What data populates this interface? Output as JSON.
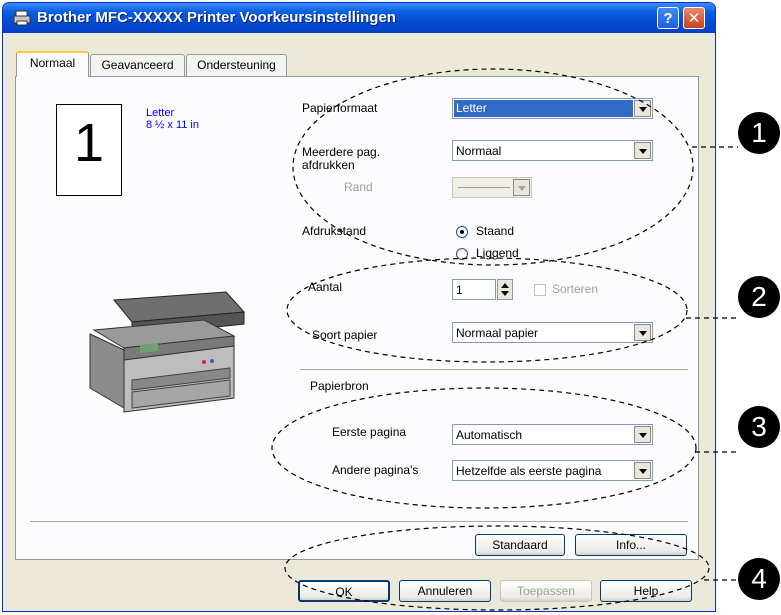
{
  "window": {
    "title": "Brother MFC-XXXXX Printer Voorkeursinstellingen",
    "help_glyph": "?",
    "close_glyph": "✕"
  },
  "tabs": [
    {
      "label": "Normaal"
    },
    {
      "label": "Geavanceerd"
    },
    {
      "label": "Ondersteuning"
    }
  ],
  "preview": {
    "page_number": "1",
    "paper_name": "Letter",
    "paper_size": "8 ½ x 11 in"
  },
  "settings": {
    "papierformaat": {
      "label": "Papierformaat",
      "value": "Letter"
    },
    "meerdere": {
      "label_line1": "Meerdere pag.",
      "label_line2": "afdrukken",
      "value": "Normaal"
    },
    "rand": {
      "label": "Rand"
    },
    "afdrukstand": {
      "label": "Afdrukstand",
      "options": [
        "Staand",
        "Liggend"
      ],
      "selected": "Staand"
    },
    "aantal": {
      "label": "Aantal",
      "value": "1"
    },
    "sorteren": {
      "label": "Sorteren",
      "checked": false
    },
    "soort_papier": {
      "label": "Soort papier",
      "value": "Normaal papier"
    },
    "papierbron": {
      "label": "Papierbron"
    },
    "eerste_pagina": {
      "label": "Eerste pagina",
      "value": "Automatisch"
    },
    "andere_paginas": {
      "label": "Andere pagina's",
      "value": "Hetzelfde als eerste pagina"
    }
  },
  "buttons": {
    "standaard": "Standaard",
    "info": "Info...",
    "ok": "OK",
    "annuleren": "Annuleren",
    "toepassen": "Toepassen",
    "help": "Help"
  },
  "callouts": [
    "1",
    "2",
    "3",
    "4"
  ],
  "colors": {
    "titlebar": "#0348d0",
    "dialog_bg": "#ece9d8",
    "selection": "#316ac5",
    "preview_text": "#0000ff"
  }
}
